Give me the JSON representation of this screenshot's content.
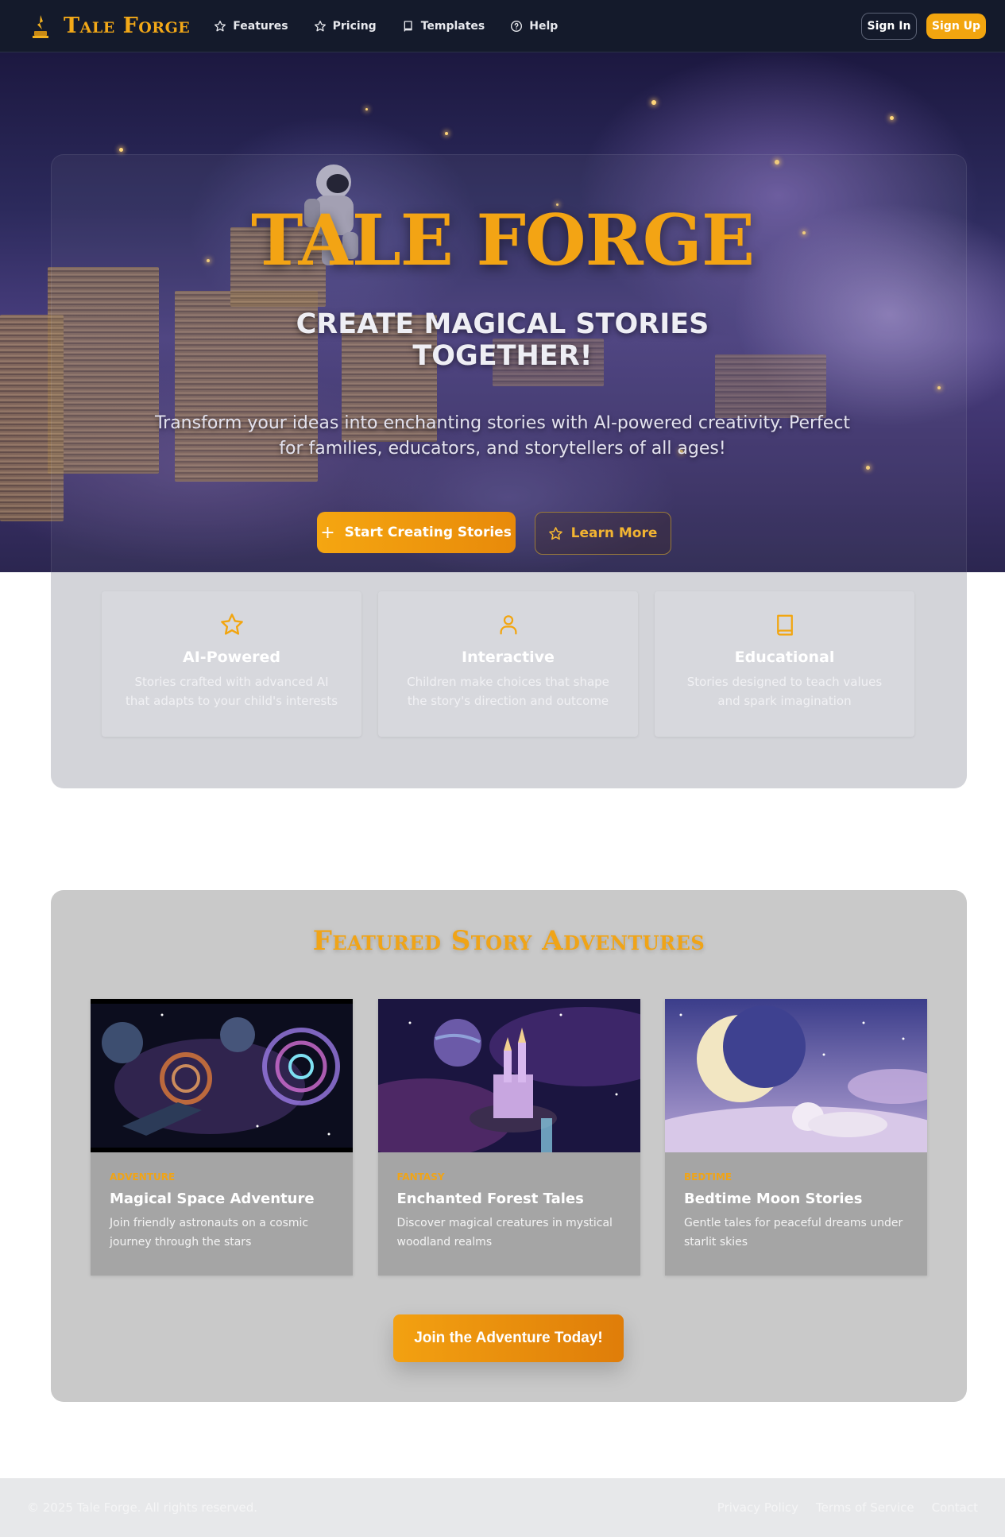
{
  "nav": {
    "brand": "Tale Forge",
    "links": [
      {
        "label": "Features",
        "icon": "star-icon"
      },
      {
        "label": "Pricing",
        "icon": "star-icon"
      },
      {
        "label": "Templates",
        "icon": "book-icon"
      },
      {
        "label": "Help",
        "icon": "help-circle-icon"
      }
    ],
    "sign_in": "Sign In",
    "sign_up": "Sign Up"
  },
  "hero": {
    "title": "TALE FORGE",
    "subtitle_line1": "CREATE MAGICAL STORIES",
    "subtitle_line2": "TOGETHER!",
    "description": "Transform your ideas into enchanting stories with AI-powered creativity. Perfect for families, educators, and storytellers of all ages!",
    "start_button": "Start Creating Stories",
    "learn_button": "Learn More"
  },
  "features": [
    {
      "icon": "star-icon",
      "title": "AI-Powered",
      "description": "Stories crafted with advanced AI that adapts to your child's interests"
    },
    {
      "icon": "user-icon",
      "title": "Interactive",
      "description": "Children make choices that shape the story's direction and outcome"
    },
    {
      "icon": "book-icon",
      "title": "Educational",
      "description": "Stories designed to teach values and spark imagination"
    }
  ],
  "featured": {
    "title": "Featured Story Adventures",
    "stories": [
      {
        "category": "Adventure",
        "title": "Magical Space Adventure",
        "description": "Join friendly astronauts on a cosmic journey through the stars"
      },
      {
        "category": "Fantasy",
        "title": "Enchanted Forest Tales",
        "description": "Discover magical creatures in mystical woodland realms"
      },
      {
        "category": "Bedtime",
        "title": "Bedtime Moon Stories",
        "description": "Gentle tales for peaceful dreams under starlit skies"
      }
    ],
    "join_button": "Join the Adventure Today!"
  },
  "footer": {
    "copyright": "© 2025 Tale Forge. All rights reserved.",
    "links": [
      "Privacy Policy",
      "Terms of Service",
      "Contact"
    ]
  },
  "colors": {
    "accent": "#f2a50f",
    "nav_bg": "#141a2b",
    "panel_bg": "#d3d4d9",
    "featured_bg": "#c9c9c9"
  }
}
